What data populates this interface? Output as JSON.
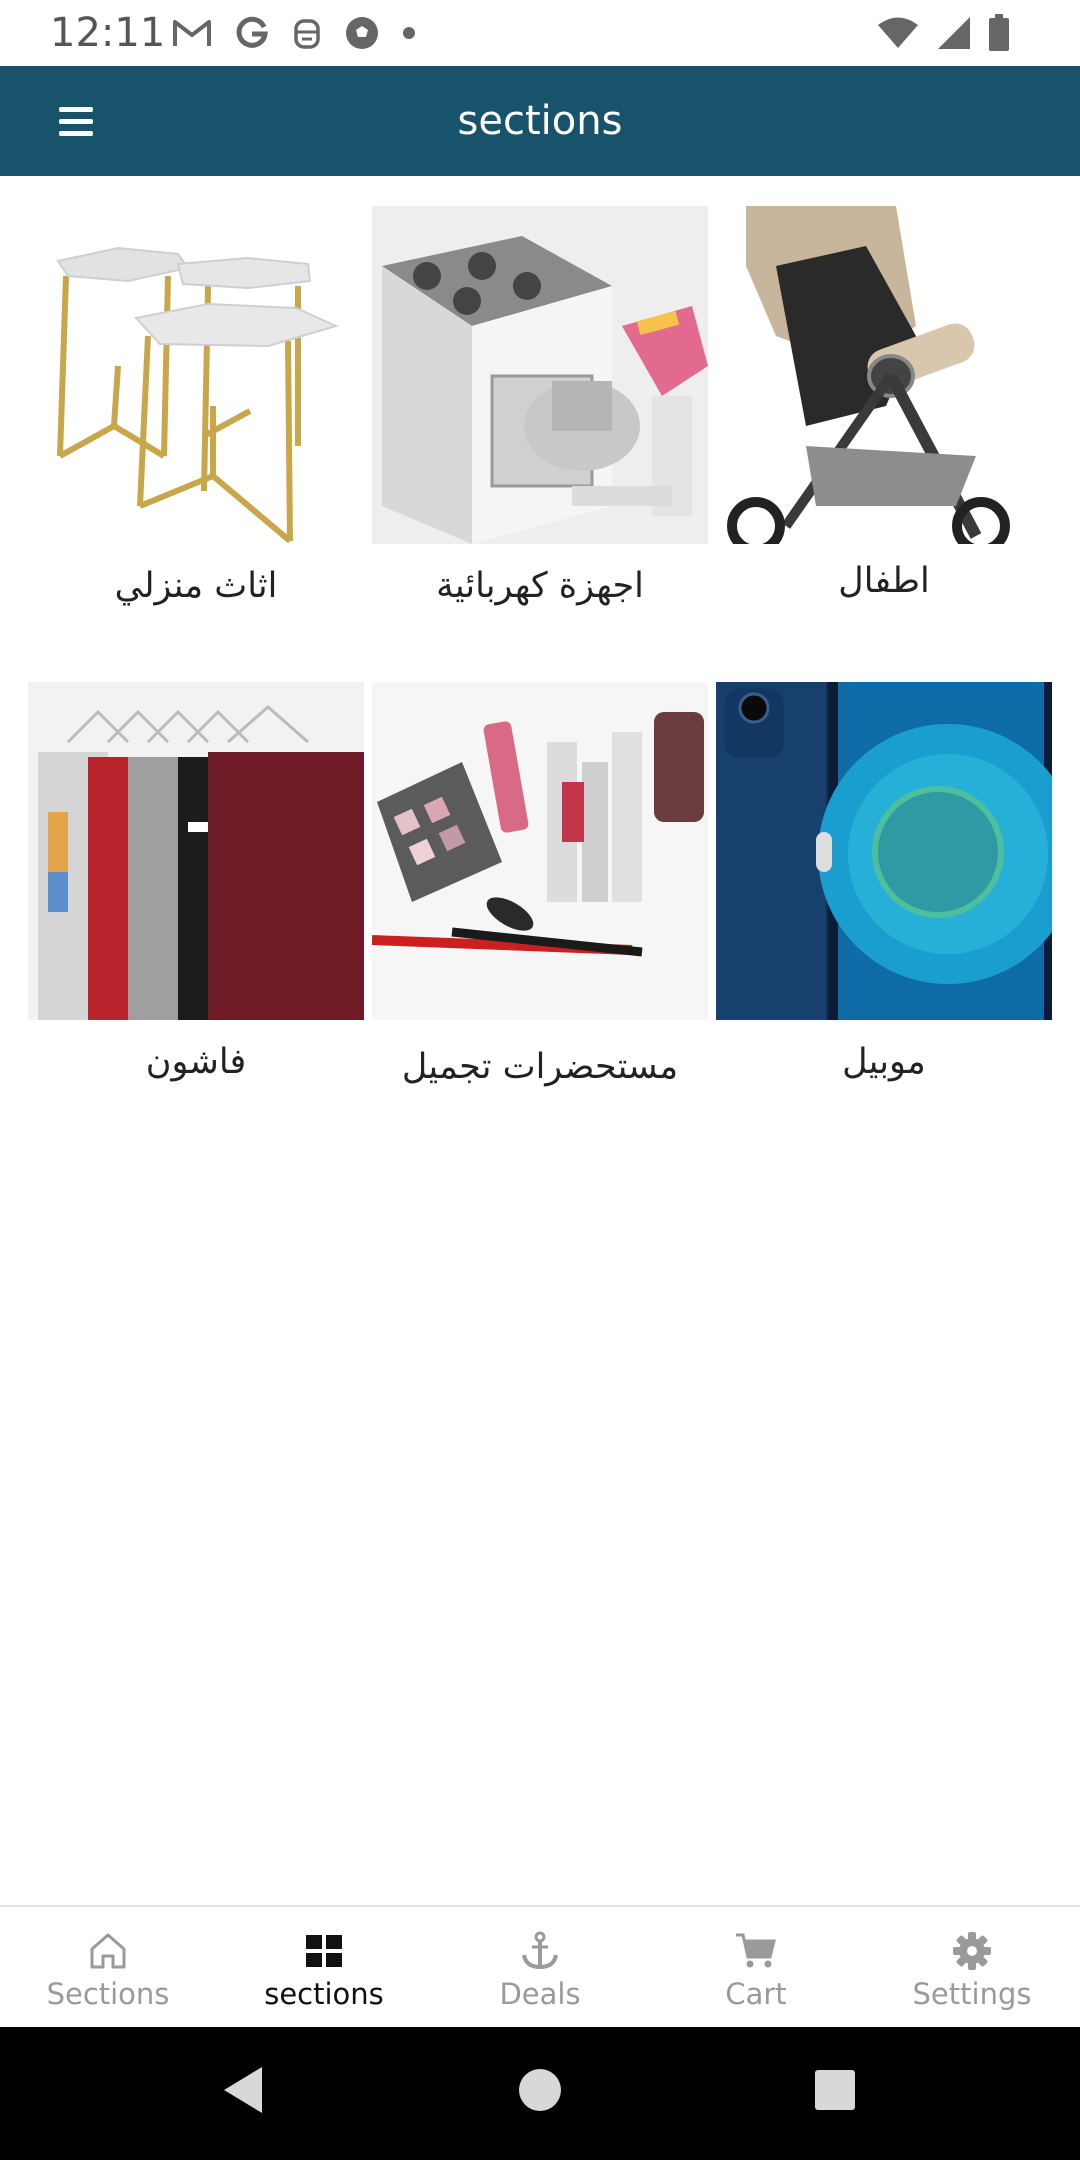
{
  "status_bar": {
    "time": "12:11",
    "left_icons": [
      "gmail-icon",
      "google-icon",
      "android-debug-icon",
      "soccer-ball-icon",
      "dot-icon"
    ],
    "right_icons": [
      "wifi-icon",
      "cell-signal-icon",
      "battery-icon"
    ]
  },
  "app_bar": {
    "title": "sections",
    "menu_icon": "hamburger-menu-icon",
    "background": "#17536a"
  },
  "categories": [
    {
      "label": "اثاث منزلي",
      "image": "side-tables"
    },
    {
      "label": "اجهزة كهربائية",
      "image": "stove-and-mixer"
    },
    {
      "label": "اطفال",
      "image": "baby-stroller"
    },
    {
      "label": "فاشون",
      "image": "clothes-on-hangers"
    },
    {
      "label": "مستحضرات تجميل",
      "image": "cosmetics"
    },
    {
      "label": "موبيل",
      "image": "mobile-phone"
    }
  ],
  "bottom_nav": {
    "items": [
      {
        "label": "Sections",
        "icon": "home-icon",
        "active": false
      },
      {
        "label": "sections",
        "icon": "grid-icon",
        "active": true
      },
      {
        "label": "Deals",
        "icon": "anchor-icon",
        "active": false
      },
      {
        "label": "Cart",
        "icon": "cart-icon",
        "active": false
      },
      {
        "label": "Settings",
        "icon": "gear-icon",
        "active": false
      }
    ],
    "active_color": "#111111",
    "inactive_color": "#9a9a9a"
  },
  "system_nav": [
    "back-icon",
    "home-circle-icon",
    "recents-icon"
  ]
}
